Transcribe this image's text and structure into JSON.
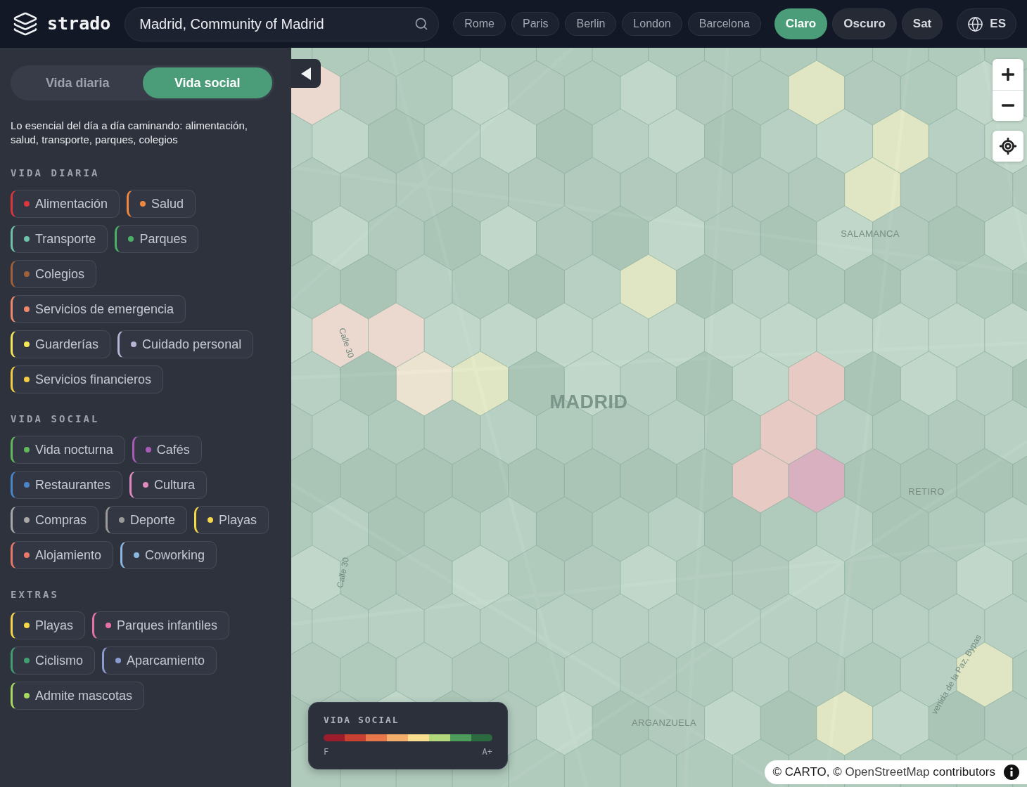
{
  "header": {
    "logo": "strado",
    "search": {
      "value": "Madrid, Community of Madrid"
    },
    "cities": [
      {
        "label": "Rome"
      },
      {
        "label": "Paris"
      },
      {
        "label": "Berlin"
      },
      {
        "label": "London"
      },
      {
        "label": "Barcelona"
      }
    ],
    "map_styles": [
      {
        "label": "Claro",
        "selected": true
      },
      {
        "label": "Oscuro",
        "selected": false
      },
      {
        "label": "Sat",
        "selected": false
      }
    ],
    "language": "ES"
  },
  "sidebar": {
    "modes": [
      {
        "label": "Vida diaria",
        "selected": false
      },
      {
        "label": "Vida social",
        "selected": true
      }
    ],
    "description": "Lo esencial del día a día caminando: alimentación, salud, transporte, parques, colegios",
    "groups": [
      {
        "title": "VIDA DIARIA",
        "categories": [
          {
            "label": "Alimentación",
            "color": "#d9363e"
          },
          {
            "label": "Salud",
            "color": "#f0883e"
          },
          {
            "label": "Transporte",
            "color": "#6fc2a8"
          },
          {
            "label": "Parques",
            "color": "#4caf68"
          },
          {
            "label": "Colegios",
            "color": "#a0603a"
          },
          {
            "label": "Servicios de emergencia",
            "color": "#f08a6a"
          },
          {
            "label": "Guarderías",
            "color": "#f5e65a"
          },
          {
            "label": "Cuidado personal",
            "color": "#b8b4d6"
          },
          {
            "label": "Servicios financieros",
            "color": "#f2cc45"
          }
        ]
      },
      {
        "title": "VIDA SOCIAL",
        "categories": [
          {
            "label": "Vida nocturna",
            "color": "#62b85a"
          },
          {
            "label": "Cafés",
            "color": "#a85cb8"
          },
          {
            "label": "Restaurantes",
            "color": "#4a86c8"
          },
          {
            "label": "Cultura",
            "color": "#e08ac0"
          },
          {
            "label": "Compras",
            "color": "#a8a8a8"
          },
          {
            "label": "Deporte",
            "color": "#9a9a9a"
          },
          {
            "label": "Playas",
            "color": "#f5d54a"
          },
          {
            "label": "Alojamiento",
            "color": "#e8796a"
          },
          {
            "label": "Coworking",
            "color": "#8ab8e0"
          }
        ]
      },
      {
        "title": "EXTRAS",
        "categories": [
          {
            "label": "Playas",
            "color": "#f5d54a"
          },
          {
            "label": "Parques infantiles",
            "color": "#e870a8"
          },
          {
            "label": "Ciclismo",
            "color": "#3f9f70"
          },
          {
            "label": "Aparcamiento",
            "color": "#8a9bd0"
          },
          {
            "label": "Admite mascotas",
            "color": "#a8d860"
          }
        ]
      }
    ]
  },
  "map": {
    "labels": [
      {
        "kind": "city",
        "text": "MADRID"
      },
      {
        "kind": "district",
        "text": "SALAMANCA"
      },
      {
        "kind": "district",
        "text": "RETIRO"
      },
      {
        "kind": "district",
        "text": "ARGANZUELA"
      },
      {
        "kind": "street",
        "text": "Calle 30"
      },
      {
        "kind": "street",
        "text": "Calle 30"
      },
      {
        "kind": "street",
        "text": "venida de la Paz, Bypas"
      }
    ],
    "legend": {
      "title": "VIDA SOCIAL",
      "scale": [
        {
          "color": "#9b1d2b"
        },
        {
          "color": "#c8402f"
        },
        {
          "color": "#e7774b"
        },
        {
          "color": "#f3ae6c"
        },
        {
          "color": "#f8de8e"
        },
        {
          "color": "#b2d87b"
        },
        {
          "color": "#4c9d5c"
        },
        {
          "color": "#2b6b3f"
        }
      ],
      "min_label": "F",
      "max_label": "A+"
    },
    "attribution": {
      "prefix": "© CARTO, © ",
      "link": "OpenStreetMap",
      "suffix": " contributors"
    }
  }
}
